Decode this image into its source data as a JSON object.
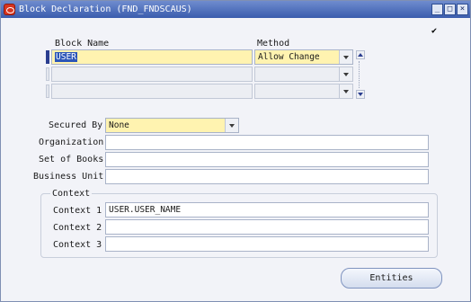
{
  "window": {
    "title": "Block Declaration (FND_FNDSCAUS)"
  },
  "blocks": {
    "col_block_name": "Block Name",
    "col_method": "Method",
    "rows": [
      {
        "name": "USER",
        "method": "Allow Change"
      },
      {
        "name": "",
        "method": ""
      },
      {
        "name": "",
        "method": ""
      }
    ]
  },
  "form": {
    "secured_by_label": "Secured By",
    "secured_by_value": "None",
    "organization_label": "Organization",
    "organization_value": "",
    "set_of_books_label": "Set of Books",
    "set_of_books_value": "",
    "business_unit_label": "Business Unit",
    "business_unit_value": ""
  },
  "context": {
    "group_title": "Context",
    "context1_label": "Context 1",
    "context1_value": "USER.USER_NAME",
    "context2_label": "Context 2",
    "context2_value": "",
    "context3_label": "Context 3",
    "context3_value": ""
  },
  "buttons": {
    "entities": "Entities"
  },
  "icons": {
    "app": "oracle-app-icon",
    "checkbox": "checkmark-icon",
    "minimize": "minimize-icon",
    "maximize": "maximize-icon",
    "close": "close-icon"
  },
  "colors": {
    "titlebar": "#3a5cad",
    "required_field": "#fff3b0",
    "selection": "#2c56b8"
  }
}
